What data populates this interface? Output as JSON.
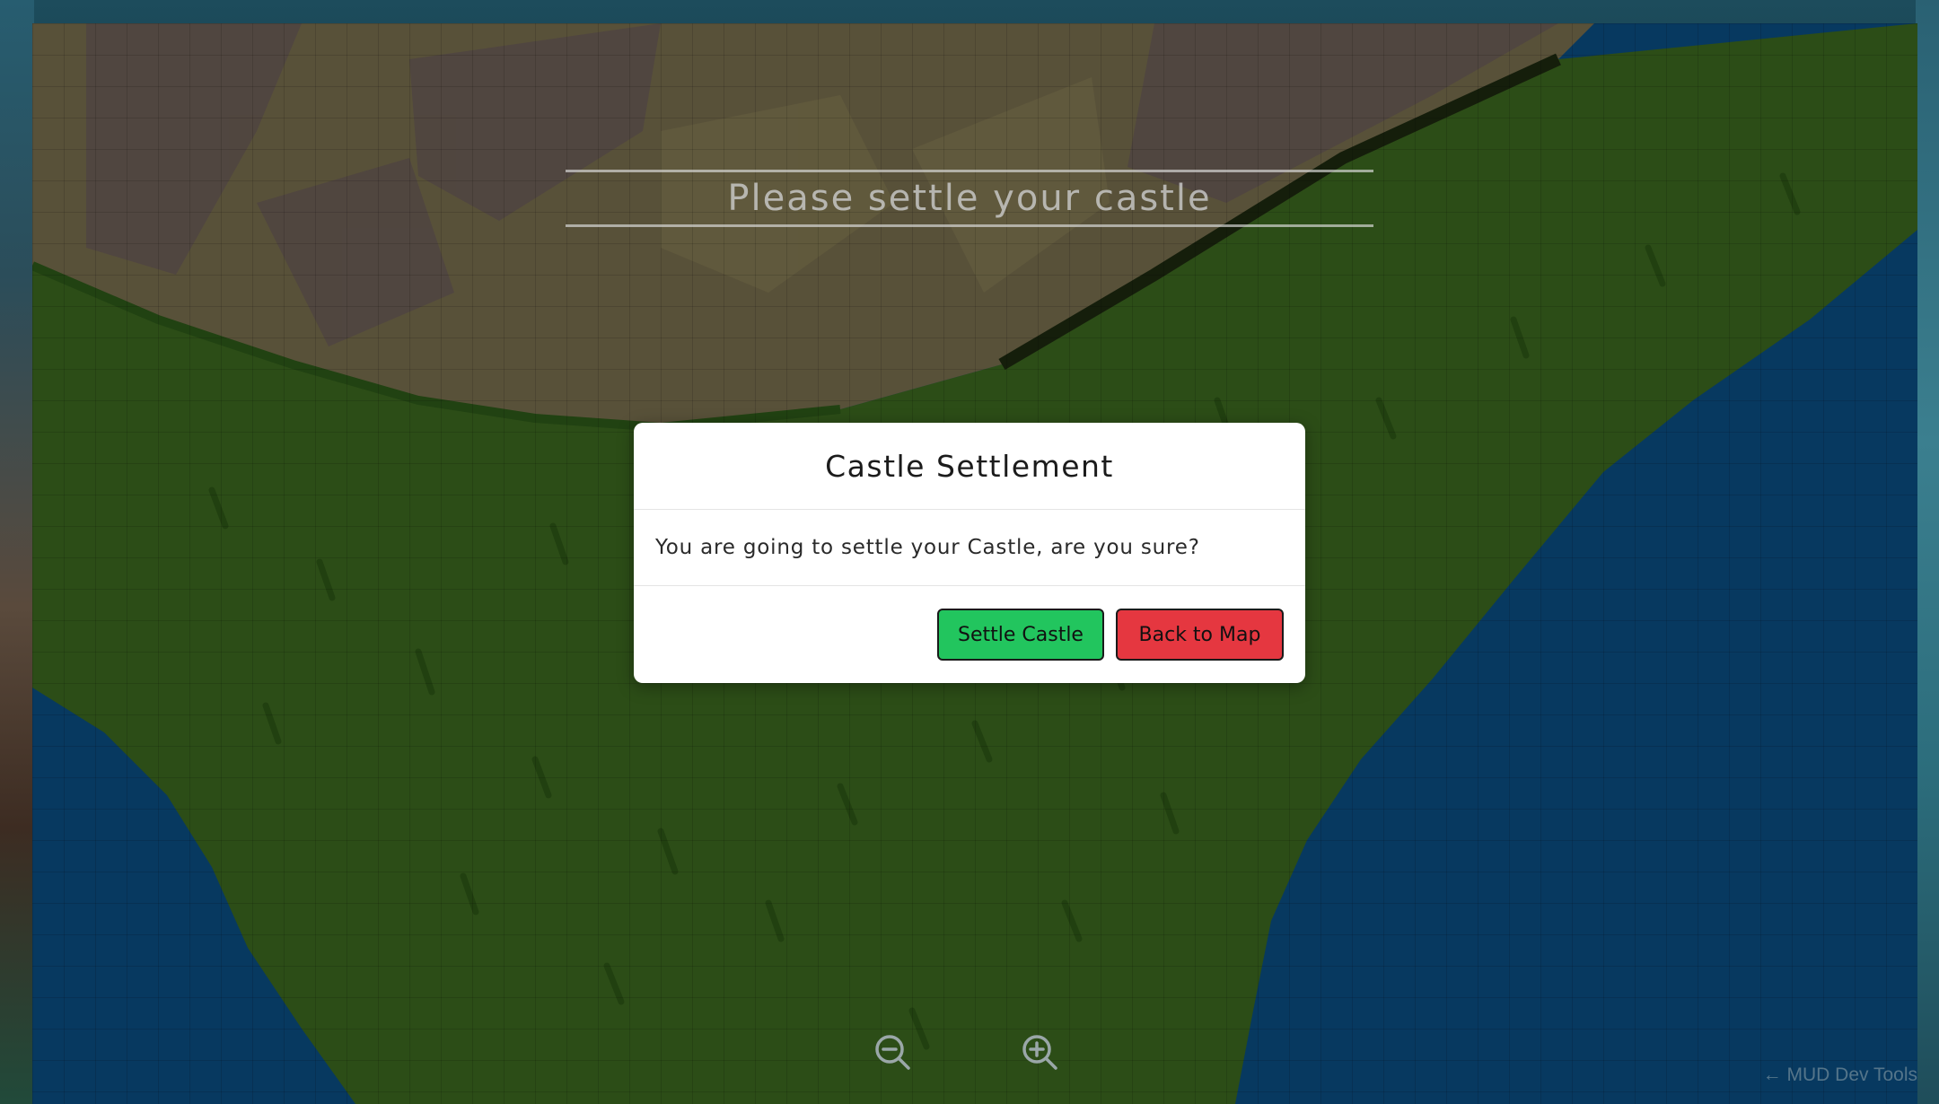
{
  "banner": {
    "title": "Please settle your castle"
  },
  "modal": {
    "title": "Castle Settlement",
    "message": "You are going to settle your Castle, are you sure?",
    "confirm_label": "Settle Castle",
    "cancel_label": "Back to Map"
  },
  "controls": {
    "zoom_out_icon": "zoom-out-icon",
    "zoom_in_icon": "zoom-in-icon",
    "devtools_label": "← MUD Dev Tools"
  },
  "colors": {
    "confirm": "#22c55e",
    "cancel": "#e53740",
    "grass": "#3b6a1f",
    "water": "#0b4f86",
    "mountain": "#6b6445"
  }
}
